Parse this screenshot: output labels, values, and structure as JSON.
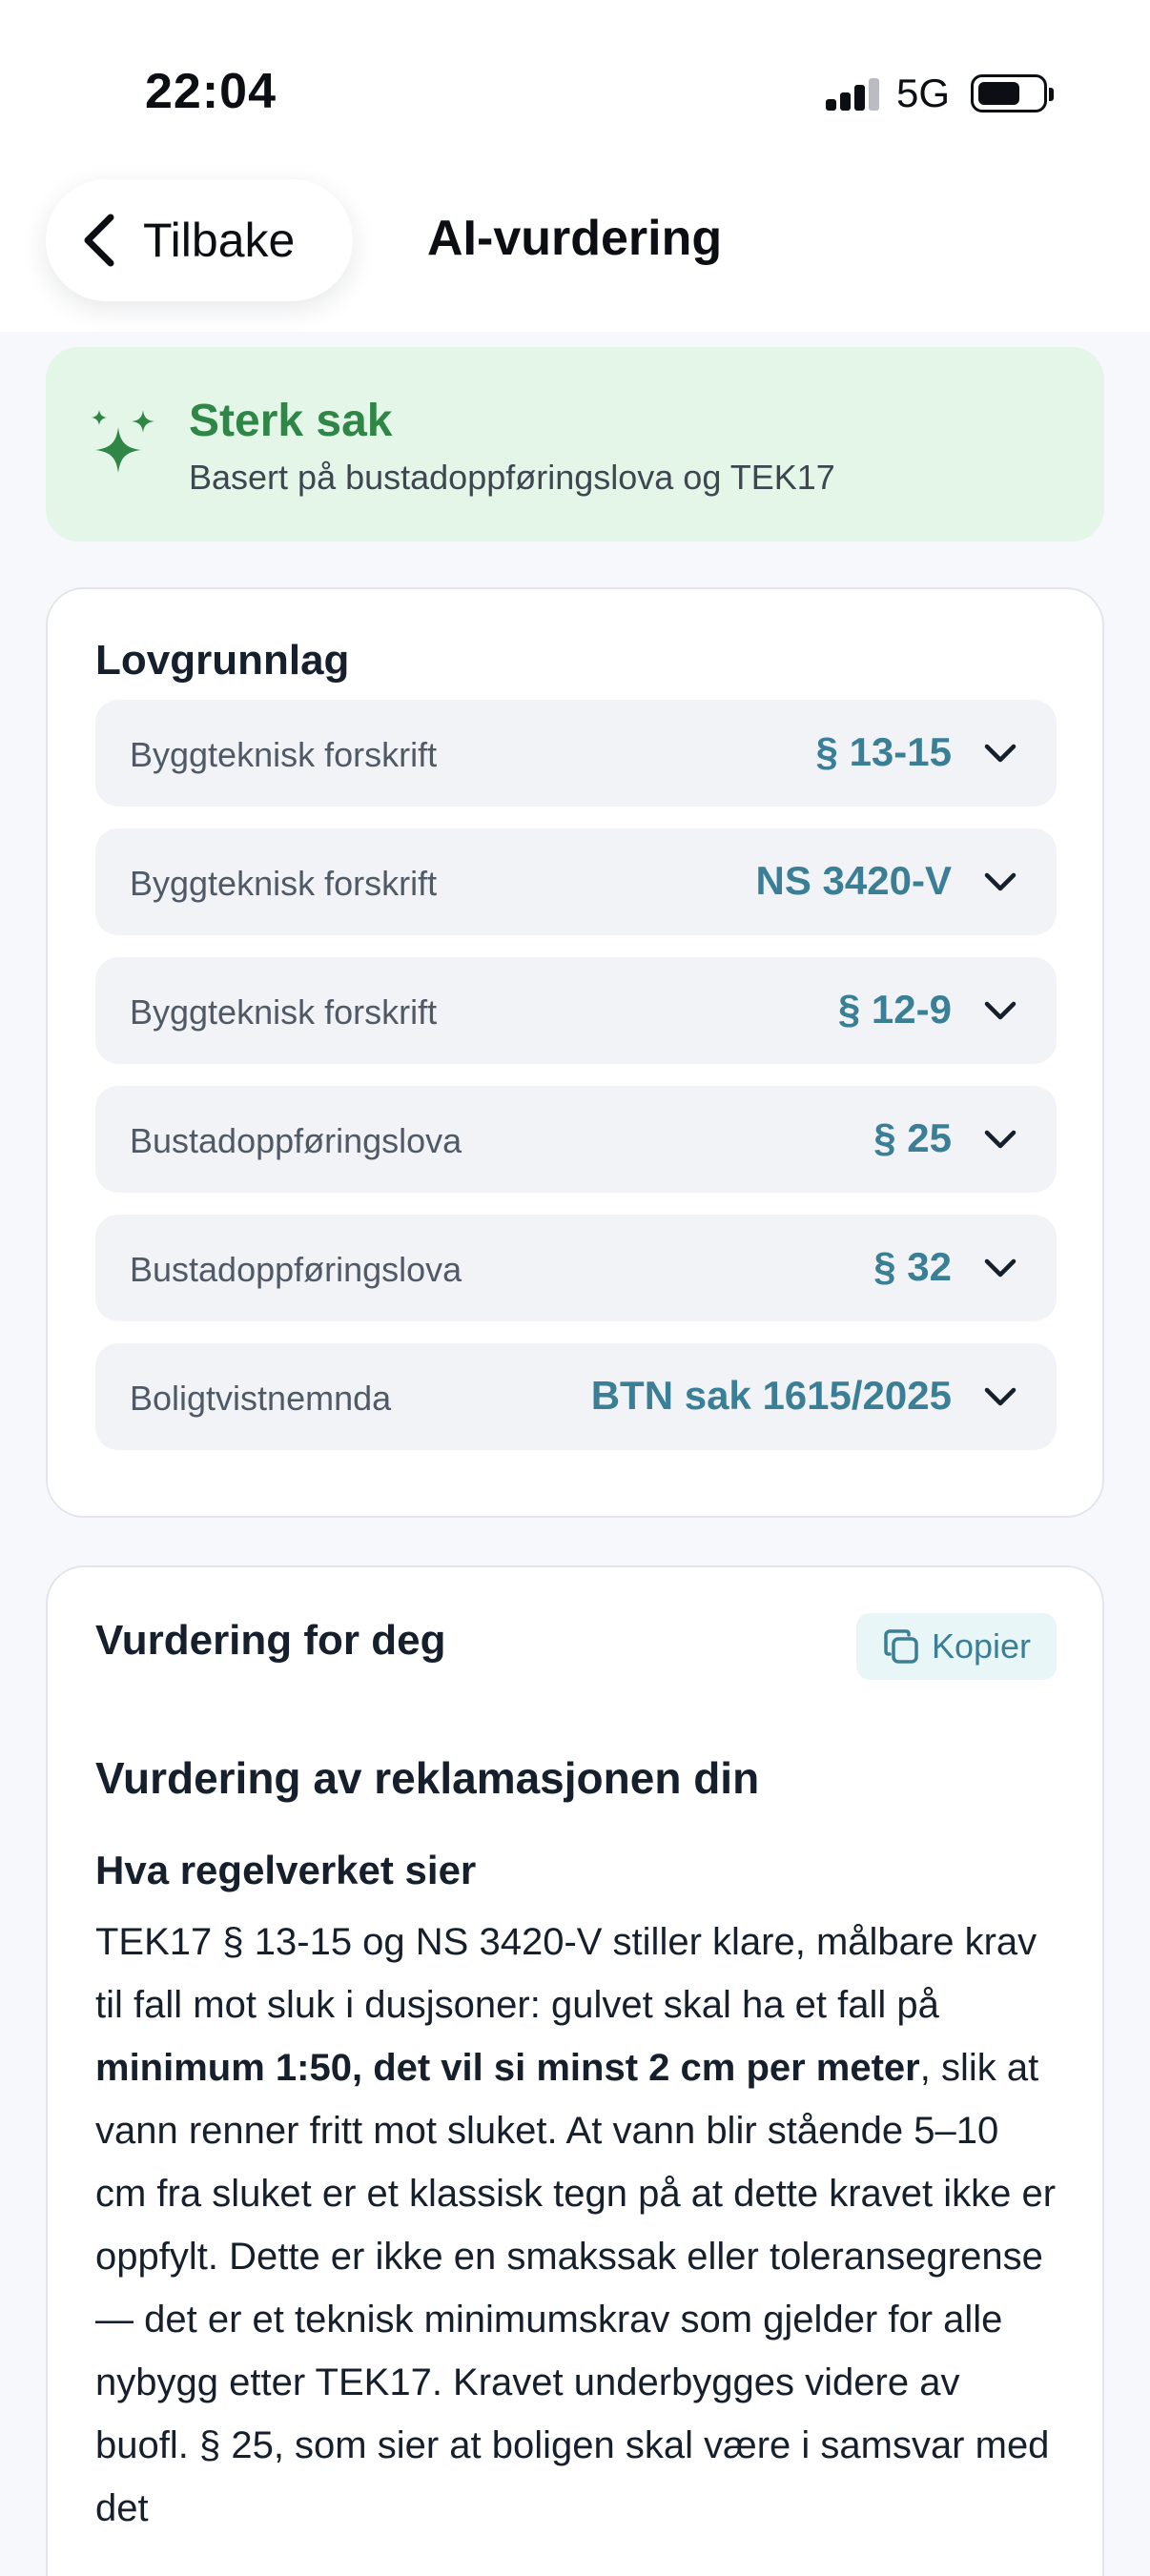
{
  "status_bar": {
    "time": "22:04",
    "network": "5G"
  },
  "header": {
    "back_label": "Tilbake",
    "title": "AI-vurdering"
  },
  "banner": {
    "title": "Sterk sak",
    "subtitle": "Basert på bustadoppføringslova og TEK17",
    "accent_color": "#2f8646",
    "background_color": "#e3f6e8"
  },
  "legal_basis": {
    "title": "Lovgrunnlag",
    "items": [
      {
        "source": "Byggteknisk forskrift",
        "reference": "§ 13-15"
      },
      {
        "source": "Byggteknisk forskrift",
        "reference": "NS 3420-V"
      },
      {
        "source": "Byggteknisk forskrift",
        "reference": "§ 12-9"
      },
      {
        "source": "Bustadoppføringslova",
        "reference": "§ 25"
      },
      {
        "source": "Bustadoppføringslova",
        "reference": "§ 32"
      },
      {
        "source": "Boligtvistnemnda",
        "reference": "BTN sak 1615/2025"
      }
    ],
    "reference_color": "#3a7f96"
  },
  "assessment": {
    "title": "Vurdering for deg",
    "copy_label": "Kopier",
    "heading": "Vurdering av reklamasjonen din",
    "section_heading": "Hva regelverket sier",
    "paragraph": {
      "part1": "TEK17 § 13-15 og NS 3420-V stiller klare, målbare krav til fall mot sluk i dusjsoner: gulvet skal ha et fall på ",
      "bold": "minimum 1:50, det vil si minst 2 cm per meter",
      "part2": ", slik at vann renner fritt mot sluket. At vann blir stående 5–10 cm fra sluket er et klassisk tegn på at dette kravet ikke er oppfylt. Dette er ikke en smakssak eller toleransegrense — det er et teknisk minimumskrav som gjelder for alle nybygg etter TEK17. Kravet underbygges videre av buofl. § 25, som sier at boligen skal være i samsvar med det"
    }
  }
}
